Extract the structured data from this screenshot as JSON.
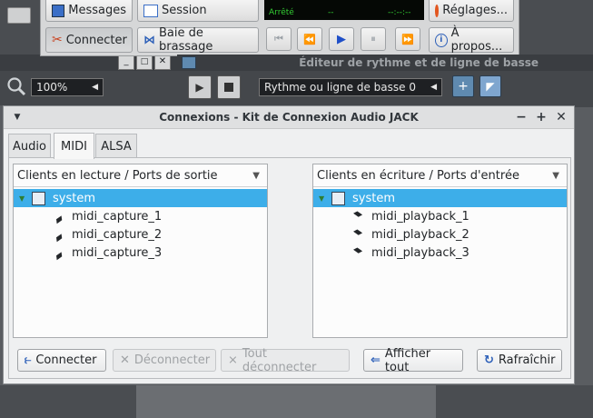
{
  "qjackctl": {
    "messages_label": "Messages",
    "session_label": "Session",
    "connect_label": "Connecter",
    "patchbay_label": "Baie de brassage",
    "status_text": "Arrêté",
    "status_dashes": "--",
    "status_time_dashes": "--:--:--",
    "settings_label": "Réglages...",
    "about_label": "À propos..."
  },
  "lmms": {
    "zoom_value": "100%",
    "editor_title": "Éditeur de rythme et de ligne de basse",
    "pattern_select": "Rythme ou ligne de basse 0"
  },
  "dialog": {
    "title": "Connexions - Kit de Connexion Audio JACK",
    "tabs": [
      {
        "label": "Audio",
        "active": false
      },
      {
        "label": "MIDI",
        "active": true
      },
      {
        "label": "ALSA",
        "active": false
      }
    ],
    "left_header": "Clients en lecture / Ports de sortie",
    "right_header": "Clients en écriture / Ports d'entrée",
    "left_client": "system",
    "right_client": "system",
    "left_ports": [
      "midi_capture_1",
      "midi_capture_2",
      "midi_capture_3"
    ],
    "right_ports": [
      "midi_playback_1",
      "midi_playback_2",
      "midi_playback_3"
    ],
    "buttons": {
      "connect": "Connecter",
      "disconnect": "Déconnecter",
      "disconnect_all": "Tout déconnecter",
      "show_all": "Afficher tout",
      "refresh": "Rafraîchir"
    }
  },
  "colors": {
    "selection": "#3daee9",
    "lcd_green": "#33cc33"
  }
}
